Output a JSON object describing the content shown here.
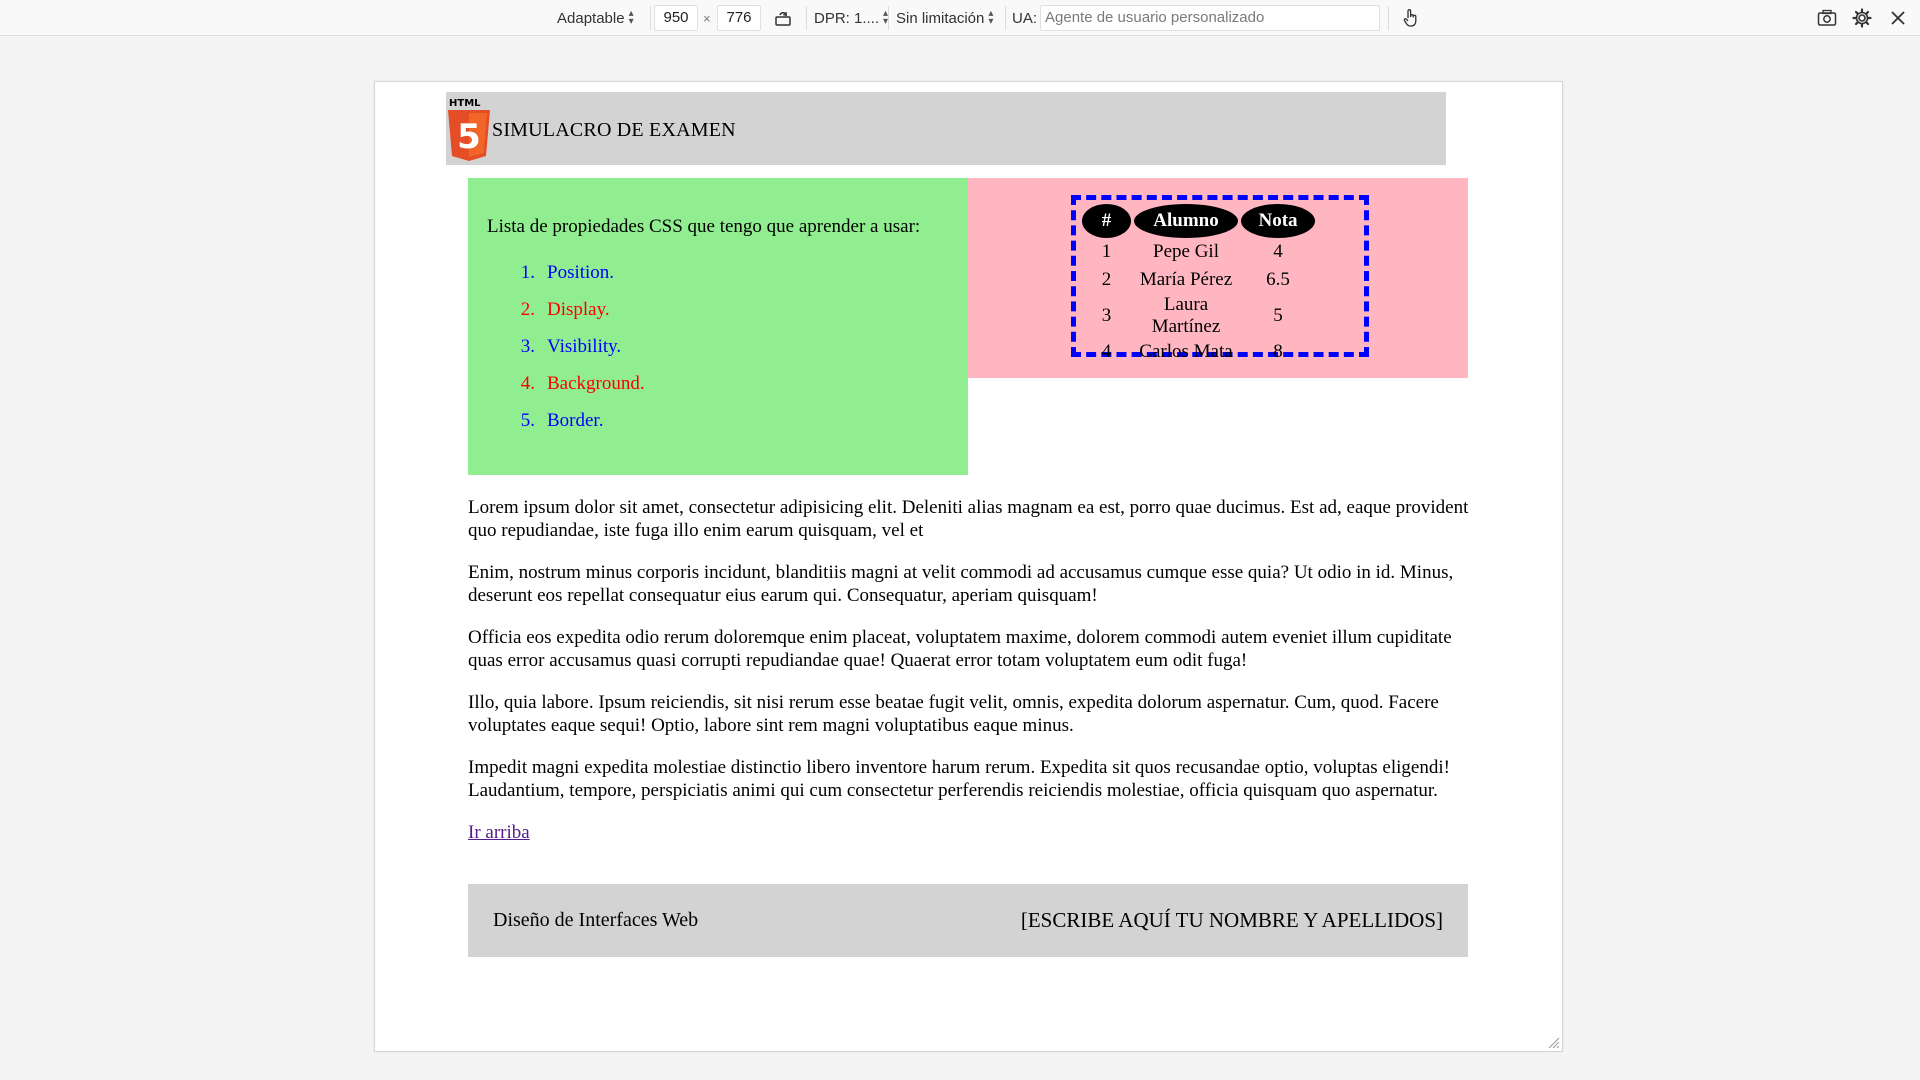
{
  "toolbar": {
    "device": "Adaptable",
    "width": "950",
    "times": "×",
    "height": "776",
    "dpr": "DPR: 1....",
    "throttling": "Sin limitación",
    "ua_label": "UA:",
    "ua_placeholder": "Agente de usuario personalizado"
  },
  "page": {
    "logo_text": "HTML",
    "logo_digit": "5",
    "title": "SIMULACRO DE EXAMEN",
    "intro": "Lista de propiedades CSS que tengo que aprender a usar:",
    "css_list": [
      {
        "num": "1.",
        "text": "Position."
      },
      {
        "num": "2.",
        "text": "Display."
      },
      {
        "num": "3.",
        "text": "Visibility."
      },
      {
        "num": "4.",
        "text": "Background."
      },
      {
        "num": "5.",
        "text": "Border."
      }
    ],
    "table": {
      "headers": [
        "#",
        "Alumno",
        "Nota"
      ],
      "rows": [
        [
          "1",
          "Pepe Gil",
          "4"
        ],
        [
          "2",
          "María Pérez",
          "6.5"
        ],
        [
          "3",
          "Laura Martínez",
          "5"
        ],
        [
          "4",
          "Carlos Mata",
          "8"
        ]
      ]
    },
    "paragraphs": [
      "Lorem ipsum dolor sit amet, consectetur adipisicing elit. Deleniti alias magnam ea est, porro quae ducimus. Est ad, eaque provident quo repudiandae, iste fuga illo enim earum quisquam, vel et",
      "Enim, nostrum minus corporis incidunt, blanditiis magni at velit commodi ad accusamus cumque esse quia? Ut odio in id. Minus, deserunt eos repellat consequatur eius earum qui. Consequatur, aperiam quisquam!",
      "Officia eos expedita odio rerum doloremque enim placeat, voluptatem maxime, dolorem commodi autem eveniet illum cupiditate quas error accusamus quasi corrupti repudiandae quae! Quaerat error totam voluptatem eum odit fuga!",
      "Illo, quia labore. Ipsum reiciendis, sit nisi rerum esse beatae fugit velit, omnis, expedita dolorum aspernatur. Cum, quod. Facere voluptates eaque sequi! Optio, labore sint rem magni voluptatibus eaque minus.",
      "Impedit magni expedita molestiae distinctio libero inventore harum rerum. Expedita sit quos recusandae optio, voluptas eligendi! Laudantium, tempore, perspiciatis animi qui cum consectetur perferendis reiciendis molestiae, officia quisquam quo aspernatur."
    ],
    "top_link": "Ir arriba",
    "footer_left": "Diseño de Interfaces Web",
    "footer_right": "[ESCRIBE AQUÍ TU NOMBRE Y APELLIDOS]"
  },
  "colors": {
    "green_box": "#90ee90",
    "pink_box": "#ffb6c1",
    "header_footer": "#d3d3d3",
    "list_odd": "#0000ff",
    "list_even": "#ff0000",
    "table_border": "#0000ff",
    "html5_orange": "#e44d26"
  },
  "icons": [
    "dropdown-arrows-icon",
    "rotate-icon",
    "touch-icon",
    "screenshot-icon",
    "settings-icon",
    "close-icon",
    "resize-handle-icon"
  ]
}
